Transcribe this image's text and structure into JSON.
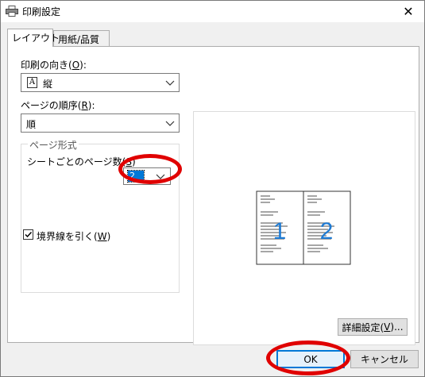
{
  "window": {
    "title": "印刷設定",
    "close_glyph": "✕"
  },
  "tabs": [
    {
      "label": "レイアウト",
      "active": true
    },
    {
      "label": "用紙/品質",
      "active": false
    }
  ],
  "orientation": {
    "label_pre": "印刷の向き(",
    "mnemonic": "O",
    "label_post": "):",
    "value": "縦",
    "glyph": "A"
  },
  "page_order": {
    "label_pre": "ページの順序(",
    "mnemonic": "R",
    "label_post": "):",
    "value": "順"
  },
  "page_format": {
    "legend": "ページ形式",
    "pages_per_sheet": {
      "label_pre": "シートごとのページ数(",
      "mnemonic": "S",
      "label_post": ")",
      "value": "2"
    },
    "draw_borders": {
      "label_pre": "境界線を引く(",
      "mnemonic": "W",
      "label_post": ")",
      "checked": true
    }
  },
  "preview": {
    "page_numbers": [
      "1",
      "2"
    ]
  },
  "buttons": {
    "advanced_pre": "詳細設定(",
    "advanced_mnemonic": "V",
    "advanced_post": ")...",
    "ok": "OK",
    "cancel": "キャンセル"
  },
  "colors": {
    "accent": "#0078d7",
    "highlight": "#e00000",
    "preview_digit": "#1e7bd4"
  }
}
